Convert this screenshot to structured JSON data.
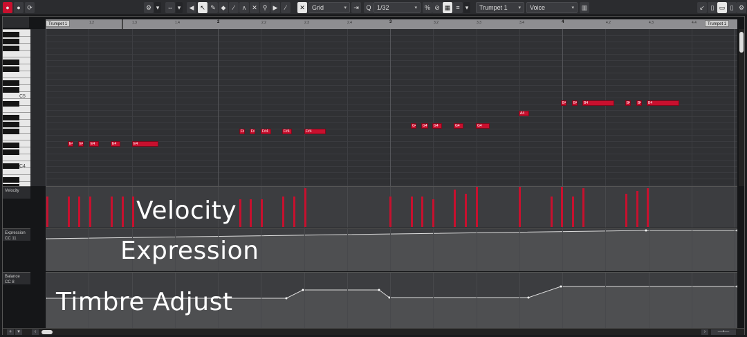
{
  "toolbar": {
    "snap_mode": "Grid",
    "quantize": "1/32",
    "track_select": "Trumpet 1",
    "voice_select": "Voice"
  },
  "ruler": {
    "bars": [
      "1",
      "2",
      "3",
      "4"
    ],
    "sub_labels": [
      "1.2",
      "1.3",
      "1.4",
      "2.2",
      "2.3",
      "2.4",
      "3.2",
      "3.3",
      "3.4",
      "4.2",
      "4.3",
      "4.4"
    ],
    "part_label_left": "Trumpet 1",
    "part_label_right": "Trumpet 1"
  },
  "keyboard": {
    "c5_label": "C5",
    "c4_label": "C4"
  },
  "notes": [
    {
      "label": "E4"
    },
    {
      "label": "E4"
    },
    {
      "label": "E4"
    },
    {
      "label": "E4"
    },
    {
      "label": "E4"
    },
    {
      "label": "F#4"
    },
    {
      "label": "F#4"
    },
    {
      "label": "F#4"
    },
    {
      "label": "F#4"
    },
    {
      "label": "F#4"
    },
    {
      "label": "G4"
    },
    {
      "label": "G4"
    },
    {
      "label": "G4"
    },
    {
      "label": "G4"
    },
    {
      "label": "G4"
    },
    {
      "label": "A4"
    },
    {
      "label": "B4"
    },
    {
      "label": "B4"
    },
    {
      "label": "B4"
    },
    {
      "label": "B4"
    },
    {
      "label": "B4"
    },
    {
      "label": "B4"
    }
  ],
  "lanes": {
    "velocity": {
      "header": "Velocity",
      "overlay": "Velocity"
    },
    "expression": {
      "header": "Expression",
      "header_sub": "CC 11",
      "overlay": "Expression"
    },
    "balance": {
      "header": "Balance",
      "header_sub": "CC 8",
      "overlay": "Timbre Adjust"
    }
  },
  "colors": {
    "note": "#c8102e",
    "accent": "#c8102e"
  },
  "icons": [
    "record-icon",
    "monitor-icon",
    "chain-icon",
    "settings-icon",
    "auto-scroll-icon",
    "pointer-tool-icon",
    "pencil-tool-icon",
    "eraser-tool-icon",
    "knife-tool-icon",
    "glue-tool-icon",
    "mute-tool-icon",
    "zoom-tool-icon",
    "line-tool-icon",
    "play-tool-icon",
    "grid-icon",
    "quantize-icon",
    "piano-icon",
    "gear-icon"
  ]
}
